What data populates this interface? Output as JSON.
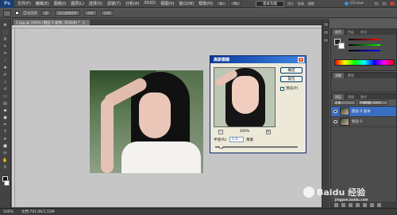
{
  "app": {
    "logo": "Ps",
    "menu": [
      "文件(F)",
      "编辑(E)",
      "图像(I)",
      "图层(L)",
      "选择(S)",
      "滤镜(T)",
      "分析(A)",
      "3D(D)",
      "视图(V)",
      "窗口(W)",
      "帮助(H)"
    ],
    "quick_buttons": [
      "Br",
      "Mb"
    ],
    "workspace_label": "基本功能",
    "workspace_links": [
      "设计",
      "绘画",
      "摄影"
    ],
    "cs_live": "CS Live"
  },
  "options_bar": {
    "checkbox_label": "自动选择",
    "group_label": "组",
    "buttons": [
      "显示变换控件",
      "对齐",
      "分布"
    ]
  },
  "document": {
    "tab_label": "1.jpg @ 100% (图层 0 副本, RGB/8) *",
    "tab_close": "×"
  },
  "dialog": {
    "title": "高斯模糊",
    "close": "✕",
    "ok_label": "确定",
    "cancel_label": "复位",
    "preview_label": "预览(P)",
    "preview_checked": true,
    "zoom_minus": "−",
    "zoom_plus": "+",
    "zoom_value": "100%",
    "radius_label": "半径(R):",
    "radius_value": "1.0",
    "radius_unit": "像素",
    "radius_slider_fraction": 0.07
  },
  "panels": {
    "color_tabs": [
      "颜色",
      "色板",
      "样式"
    ],
    "adjust_tabs": [
      "调整",
      "蒙版"
    ],
    "layers_tabs": [
      "图层",
      "通道",
      "路径"
    ],
    "blend_mode": "正常",
    "opacity": "不透明度: 100%",
    "layers": [
      {
        "name": "图层 0 副本",
        "active": true
      },
      {
        "name": "图层 0",
        "active": false
      }
    ]
  },
  "status": {
    "zoom": "100%",
    "doc_info": "文档:791.0K/1.55M"
  },
  "watermark": {
    "text": "Baidu 经验",
    "sub": "jingyan.baidu.com"
  }
}
